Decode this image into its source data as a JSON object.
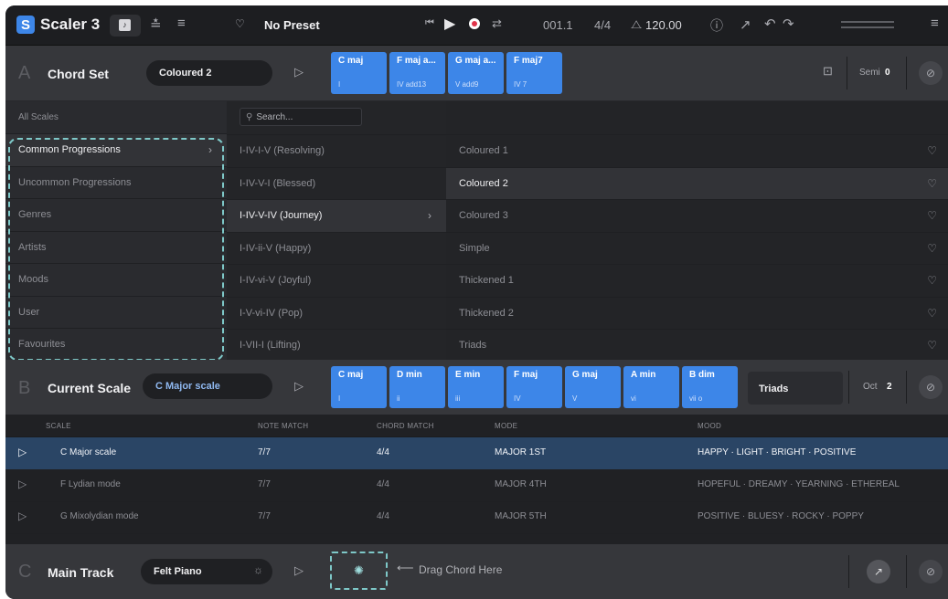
{
  "app": {
    "name": "Scaler 3",
    "preset": "No Preset",
    "position": "001.1",
    "time_signature": "4/4",
    "tempo": "120.00"
  },
  "chord_set": {
    "letter": "A",
    "title": "Chord Set",
    "selected": "Coloured 2",
    "chords": [
      {
        "name": "C maj",
        "degree": "I"
      },
      {
        "name": "F maj a...",
        "degree": "IV add13"
      },
      {
        "name": "G maj a...",
        "degree": "V add9"
      },
      {
        "name": "F maj7",
        "degree": "IV 7"
      }
    ],
    "semi_label": "Semi",
    "semi_value": "0"
  },
  "browser": {
    "col1_header": "All Scales",
    "search_placeholder": "Search...",
    "categories": [
      "Common Progressions",
      "Uncommon Progressions",
      "Genres",
      "Artists",
      "Moods",
      "User",
      "Favourites"
    ],
    "progressions": [
      "I-IV-I-V (Resolving)",
      "I-IV-V-I (Blessed)",
      "I-IV-V-IV (Journey)",
      "I-IV-ii-V (Happy)",
      "I-IV-vi-V (Joyful)",
      "I-V-vi-IV (Pop)",
      "I-VII-I (Lifting)"
    ],
    "sets": [
      "Coloured 1",
      "Coloured 2",
      "Coloured 3",
      "Simple",
      "Thickened 1",
      "Thickened 2",
      "Triads"
    ]
  },
  "current_scale": {
    "letter": "B",
    "title": "Current Scale",
    "selected": "C Major scale",
    "chords": [
      {
        "name": "C maj",
        "degree": "I"
      },
      {
        "name": "D min",
        "degree": "ii"
      },
      {
        "name": "E min",
        "degree": "iii"
      },
      {
        "name": "F maj",
        "degree": "IV"
      },
      {
        "name": "G maj",
        "degree": "V"
      },
      {
        "name": "A min",
        "degree": "vi"
      },
      {
        "name": "B dim",
        "degree": "vii o"
      }
    ],
    "voicing": "Triads",
    "oct_label": "Oct",
    "oct_value": "2"
  },
  "scale_table": {
    "headers": [
      "SCALE",
      "NOTE MATCH",
      "CHORD MATCH",
      "MODE",
      "MOOD"
    ],
    "rows": [
      {
        "scale": "C Major scale",
        "note_match": "7/7",
        "chord_match": "4/4",
        "mode": "MAJOR 1ST",
        "mood": "HAPPY · LIGHT · BRIGHT · POSITIVE"
      },
      {
        "scale": "F Lydian mode",
        "note_match": "7/7",
        "chord_match": "4/4",
        "mode": "MAJOR 4TH",
        "mood": "HOPEFUL · DREAMY · YEARNING · ETHEREAL"
      },
      {
        "scale": "G Mixolydian mode",
        "note_match": "7/7",
        "chord_match": "4/4",
        "mode": "MAJOR 5TH",
        "mood": "POSITIVE · BLUESY · ROCKY · POPPY"
      }
    ]
  },
  "main_track": {
    "letter": "C",
    "title": "Main Track",
    "instrument": "Felt Piano",
    "drop_hint": "Drag Chord Here"
  },
  "colors": {
    "accent": "#3d86e8",
    "highlight": "#2a4565",
    "dashed": "#7ec8c8"
  }
}
